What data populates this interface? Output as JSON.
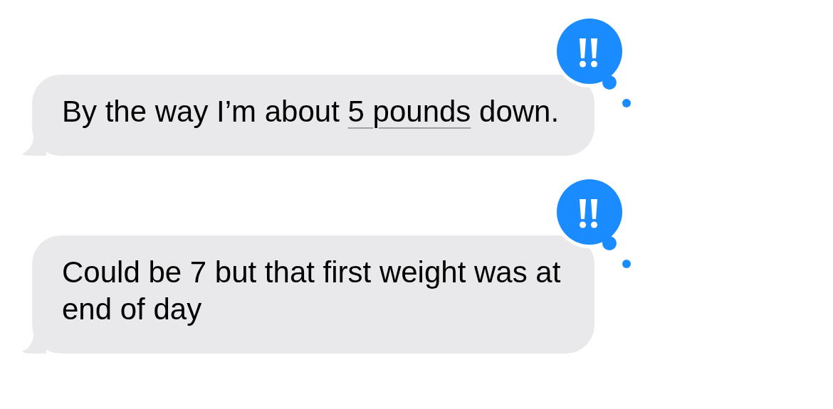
{
  "messages": [
    {
      "text_before": "By the way I’m about ",
      "link": "5 pounds",
      "text_after": " down.",
      "reaction": {
        "kind": "emphasize"
      }
    },
    {
      "text_before": "Could be 7 but that first weight was at end of day",
      "reaction": {
        "kind": "emphasize"
      }
    }
  ]
}
